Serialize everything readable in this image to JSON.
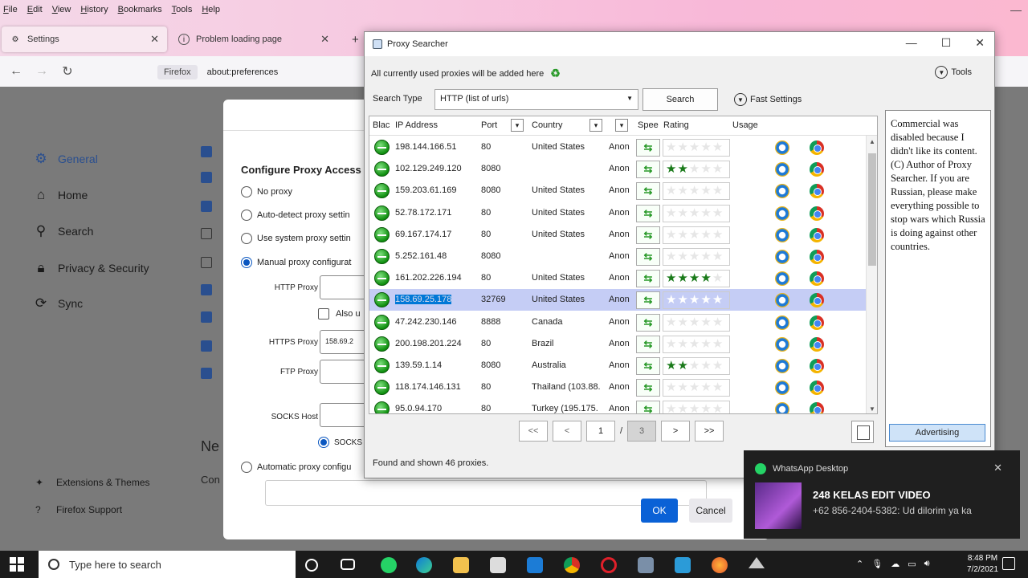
{
  "firefox": {
    "menu": [
      "File",
      "Edit",
      "View",
      "History",
      "Bookmarks",
      "Tools",
      "Help"
    ],
    "tabs": [
      {
        "label": "Settings",
        "active": true
      },
      {
        "label": "Problem loading page",
        "active": false
      }
    ],
    "url_chip": "Firefox",
    "url": "about:preferences",
    "sidebar": {
      "items": [
        "General",
        "Home",
        "Search",
        "Privacy & Security",
        "Sync"
      ],
      "footer": [
        "Extensions & Themes",
        "Firefox Support"
      ]
    },
    "partial_heading": "Ne",
    "partial_text": "Con"
  },
  "connection_dialog": {
    "title": "Configure Proxy Access",
    "options": [
      "No proxy",
      "Auto-detect proxy settin",
      "Use system proxy settin",
      "Manual proxy configurat"
    ],
    "http_proxy_label": "HTTP Proxy",
    "also_use_label": "Also u",
    "https_proxy_label": "HTTPS Proxy",
    "https_proxy_value": "158.69.2",
    "ftp_proxy_label": "FTP Proxy",
    "socks_host_label": "SOCKS Host",
    "socks_radio_label": "SOCKS",
    "auto_config_label": "Automatic proxy configu",
    "ok_label": "OK",
    "cancel_label": "Cancel"
  },
  "proxy_searcher": {
    "title": "Proxy Searcher",
    "info": "All currently used proxies will be added here",
    "tools_label": "Tools",
    "search_type_label": "Search Type",
    "search_type_value": "HTTP (list of urls)",
    "search_button": "Search",
    "fast_settings": "Fast Settings",
    "columns": [
      "Blac",
      "IP Address",
      "Port",
      "Country",
      "Anon",
      "Spee",
      "Rating",
      "Usage"
    ],
    "rows": [
      {
        "ip": "198.144.166.51",
        "port": "80",
        "country": "United States",
        "anon": "Anon",
        "stars": 0
      },
      {
        "ip": "102.129.249.120",
        "port": "8080",
        "country": "",
        "anon": "Anon",
        "stars": 2
      },
      {
        "ip": "159.203.61.169",
        "port": "8080",
        "country": "United States",
        "anon": "Anon",
        "stars": 0
      },
      {
        "ip": "52.78.172.171",
        "port": "80",
        "country": "United States",
        "anon": "Anon",
        "stars": 0
      },
      {
        "ip": "69.167.174.17",
        "port": "80",
        "country": "United States",
        "anon": "Anon",
        "stars": 0
      },
      {
        "ip": "5.252.161.48",
        "port": "8080",
        "country": "",
        "anon": "Anon",
        "stars": 0
      },
      {
        "ip": "161.202.226.194",
        "port": "80",
        "country": "United States",
        "anon": "Anon",
        "stars": 4
      },
      {
        "ip": "158.69.25.178",
        "port": "32769",
        "country": "United States",
        "anon": "Anon",
        "stars": 5,
        "selected": true
      },
      {
        "ip": "47.242.230.146",
        "port": "8888",
        "country": "Canada",
        "anon": "Anon",
        "stars": 0
      },
      {
        "ip": "200.198.201.224",
        "port": "80",
        "country": "Brazil",
        "anon": "Anon",
        "stars": 0
      },
      {
        "ip": "139.59.1.14",
        "port": "8080",
        "country": "Australia",
        "anon": "Anon",
        "stars": 2
      },
      {
        "ip": "118.174.146.131",
        "port": "80",
        "country": "Thailand (103.88.",
        "anon": "Anon",
        "stars": 0
      },
      {
        "ip": "95.0.94.170",
        "port": "80",
        "country": "Turkey (195.175.",
        "anon": "Anon",
        "stars": 0
      }
    ],
    "pager": {
      "first": "<<",
      "prev": "<",
      "page": "1",
      "sep": "/",
      "total": "3",
      "next": ">",
      "last": ">>"
    },
    "found_text": "Found and shown 46 proxies.",
    "ad_text": "Commercial was disabled because I didn't like its content. (C) Author of Proxy Searcher. If you are Russian, please make everything possible to stop wars which Russia is doing against other countries.",
    "ad_button": "Advertising"
  },
  "toast": {
    "app": "WhatsApp Desktop",
    "title": "248 KELAS EDIT VIDEO",
    "message": "+62 856-2404-5382: Ud dilorim ya ka"
  },
  "taskbar": {
    "search_placeholder": "Type here to search",
    "time": "8:48 PM",
    "date": "7/2/2021"
  }
}
